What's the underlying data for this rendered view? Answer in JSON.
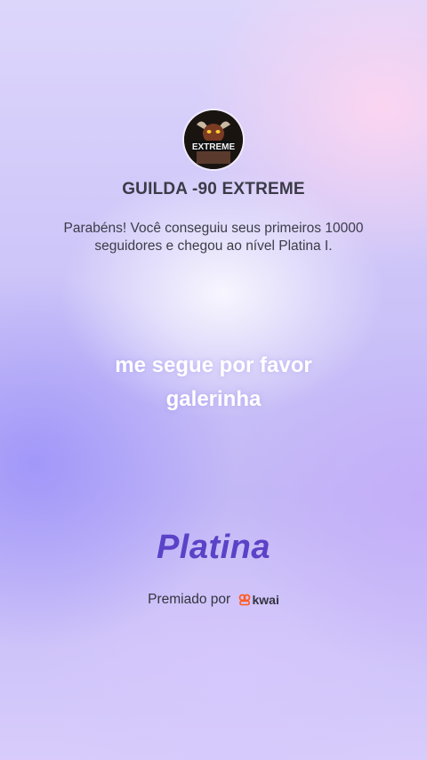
{
  "guild": {
    "name": "GUILDA -90 EXTREME",
    "avatar_icon": "guild-avatar-extreme-logo",
    "avatar_text": "EXTREME"
  },
  "congrats_message": "Parabéns! Você conseguiu seus primeiros 10000 seguidores e chegou ao nível Platina I.",
  "user_message": {
    "line1": "me segue por favor",
    "line2": "galerinha"
  },
  "tier": "Platina",
  "award": {
    "prefix": "Premiado por",
    "brand": "kwai",
    "brand_icon": "kwai-logo-icon",
    "brand_color": "#ff5a1f"
  },
  "colors": {
    "tier_text": "#5b42c7",
    "user_message_text": "#ffffff",
    "body_text": "#3c3c48"
  }
}
